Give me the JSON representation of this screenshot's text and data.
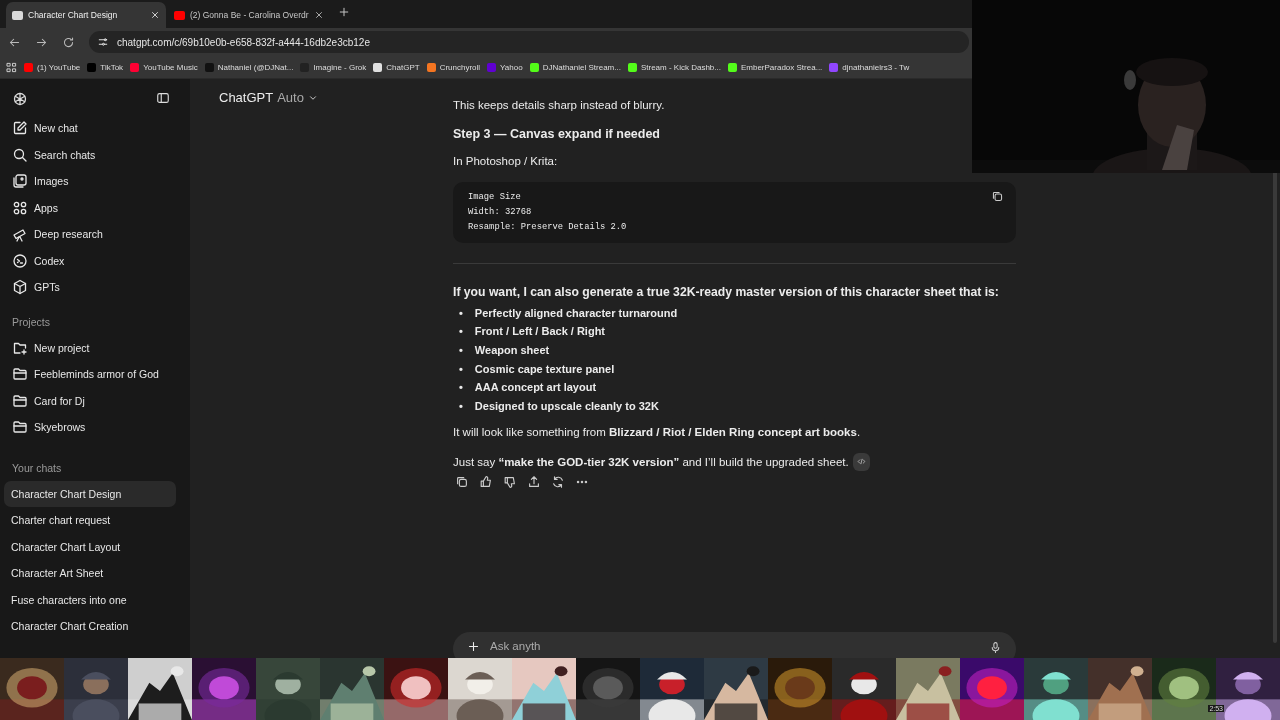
{
  "browser": {
    "tabs": [
      {
        "title": "Character Chart Design",
        "selected": true,
        "color": "#d9d9d9"
      },
      {
        "title": "(2) Gonna Be - Carolina Overdr",
        "selected": false,
        "color": "#ff0000"
      }
    ],
    "url": "chatgpt.com/c/69b10e0b-e658-832f-a444-16db2e3cb12e",
    "bookmarks": [
      {
        "label": "(1) YouTube",
        "color": "#ff0000"
      },
      {
        "label": "TikTok",
        "color": "#000000"
      },
      {
        "label": "YouTube Music",
        "color": "#ff0033"
      },
      {
        "label": "Nathaniel (@DJNat...",
        "color": "#111111"
      },
      {
        "label": "Imagine - Grok",
        "color": "#222222"
      },
      {
        "label": "ChatGPT",
        "color": "#e0e0e0"
      },
      {
        "label": "Crunchyroll",
        "color": "#f47521"
      },
      {
        "label": "Yahoo",
        "color": "#6001d2"
      },
      {
        "label": "DJNathaniel Stream...",
        "color": "#53fc18"
      },
      {
        "label": "Stream - Kick Dashb...",
        "color": "#53fc19"
      },
      {
        "label": "EmberParadox Strea...",
        "color": "#53fc1a"
      },
      {
        "label": "djnathanielrs3 - Tw",
        "color": "#9146ff"
      }
    ]
  },
  "sidebar": {
    "nav": [
      {
        "label": "New chat",
        "kind": "edit"
      },
      {
        "label": "Search chats",
        "kind": "search"
      },
      {
        "label": "Images",
        "kind": "images"
      },
      {
        "label": "Apps",
        "kind": "apps"
      },
      {
        "label": "Deep research",
        "kind": "research"
      },
      {
        "label": "Codex",
        "kind": "codex"
      },
      {
        "label": "GPTs",
        "kind": "gpts"
      }
    ],
    "projects_heading": "Projects",
    "projects": [
      {
        "label": "New project",
        "kind": "new"
      },
      {
        "label": "Feebleminds armor of God",
        "kind": "folder"
      },
      {
        "label": "Card for Dj",
        "kind": "folder"
      },
      {
        "label": "Skyebrows",
        "kind": "folder"
      }
    ],
    "chats_heading": "Your chats",
    "chats": [
      {
        "label": "Character Chart Design",
        "selected": true
      },
      {
        "label": "Charter chart request",
        "selected": false
      },
      {
        "label": "Character Chart Layout",
        "selected": false
      },
      {
        "label": "Character Art Sheet",
        "selected": false
      },
      {
        "label": "Fuse characters into one",
        "selected": false
      },
      {
        "label": "Character Chart Creation",
        "selected": false
      }
    ]
  },
  "header": {
    "title": "ChatGPT",
    "model": "Auto"
  },
  "message": {
    "blocks": [
      {
        "kind": "paragraph",
        "text": "This keeps details sharp instead of blurry."
      },
      {
        "kind": "heading",
        "text": "Step 3 — Canvas expand if needed"
      },
      {
        "kind": "paragraph",
        "text": "In Photoshop / Krita:"
      },
      {
        "kind": "code",
        "lines": [
          "Image Size",
          "Width: 32768",
          "Resample: Preserve Details 2.0"
        ]
      },
      {
        "kind": "rule"
      },
      {
        "kind": "heading",
        "text": "If you want, I can also generate a true 32K-ready master version of this character sheet that is:"
      },
      {
        "kind": "list",
        "marker": "•",
        "items": [
          "Perfectly aligned character turnaround",
          "Front / Left / Back / Right",
          "Weapon sheet",
          "Cosmic cape texture panel",
          "AAA concept art layout",
          "Designed to upscale cleanly to 32K"
        ]
      },
      {
        "kind": "paragraph",
        "text": "It will look like something from **Blizzard / Riot / Elden Ring concept art books**."
      },
      {
        "kind": "closing",
        "text": "Just say **“make the GOD-tier 32K version”** and I’ll build the upgraded sheet."
      }
    ]
  },
  "composer": {
    "placeholder": "Ask anyth"
  },
  "taskbar": {
    "clock": "2:53"
  }
}
